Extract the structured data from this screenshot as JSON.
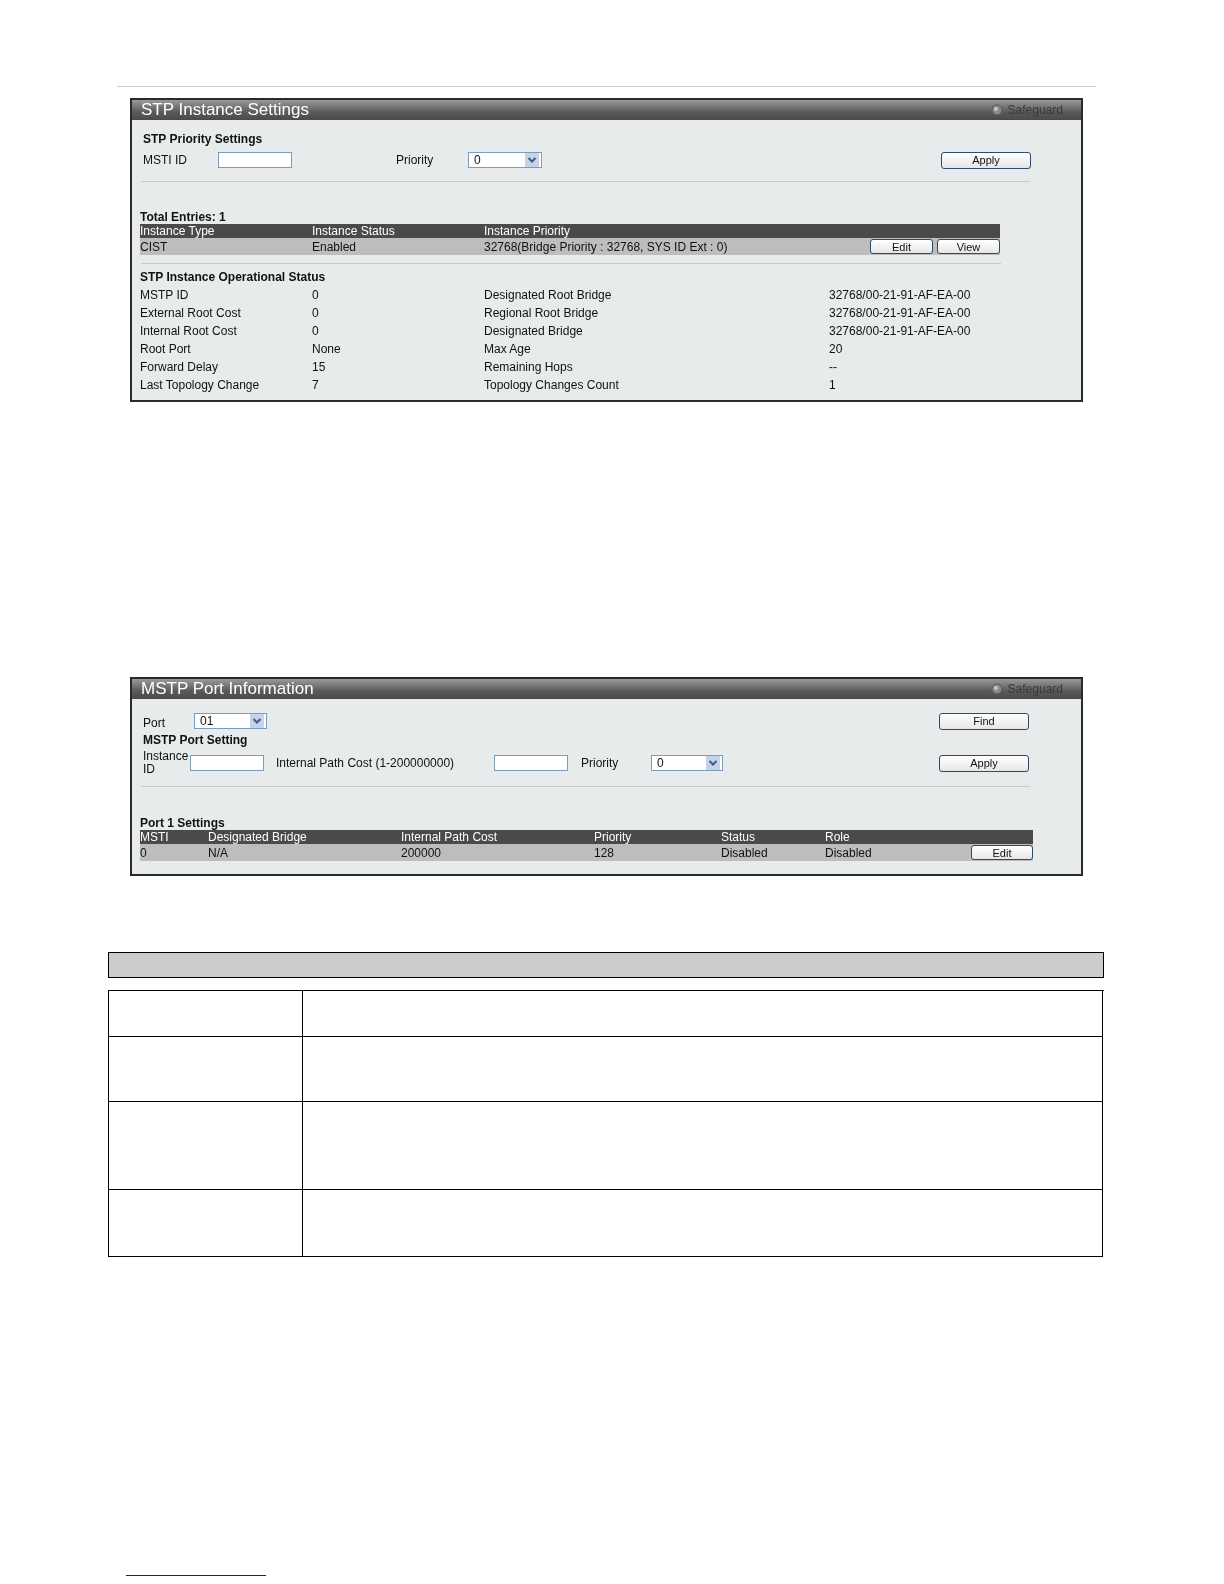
{
  "stp_instance_settings": {
    "title": "STP Instance Settings",
    "badge": "Safeguard",
    "priority_settings": {
      "heading": "STP Priority Settings",
      "msti_id_label": "MSTI ID",
      "priority_label": "Priority",
      "priority_value": "0",
      "apply_button": "Apply"
    },
    "total_entries": "Total Entries: 1",
    "table": {
      "columns": [
        "Instance Type",
        "Instance Status",
        "Instance Priority"
      ],
      "rows": [
        {
          "cells": [
            "CIST",
            "Enabled",
            "32768(Bridge Priority : 32768, SYS ID Ext : 0)"
          ],
          "buttons": [
            "Edit",
            "View"
          ]
        }
      ]
    },
    "operational_status": {
      "heading": "STP Instance Operational Status",
      "rows": [
        {
          "label": "MSTP ID",
          "value": "0",
          "label_2": "Designated Root Bridge",
          "value_2": "32768/00-21-91-AF-EA-00"
        },
        {
          "label": "External Root Cost",
          "value": "0",
          "label_2": "Regional Root Bridge",
          "value_2": "32768/00-21-91-AF-EA-00"
        },
        {
          "label": "Internal Root Cost",
          "value": "0",
          "label_2": "Designated Bridge",
          "value_2": "32768/00-21-91-AF-EA-00"
        },
        {
          "label": "Root Port",
          "value": "None",
          "label_2": "Max Age",
          "value_2": "20"
        },
        {
          "label": "Forward Delay",
          "value": "15",
          "label_2": "Remaining Hops",
          "value_2": "--"
        },
        {
          "label": "Last Topology Change",
          "value": "7",
          "label_2": "Topology Changes Count",
          "value_2": "1"
        }
      ]
    }
  },
  "mstp_port_information": {
    "title": "MSTP Port Information",
    "badge": "Safeguard",
    "port_label": "Port",
    "port_value": "01",
    "find_button": "Find",
    "port_setting": {
      "heading": "MSTP Port Setting",
      "instance_id_label": "Instance ID",
      "path_cost_label": "Internal Path Cost (1-200000000)",
      "priority_label": "Priority",
      "priority_value": "0",
      "apply_button": "Apply"
    },
    "settings_heading": "Port 1 Settings",
    "table": {
      "columns": [
        "MSTI",
        "Designated Bridge",
        "Internal Path Cost",
        "Priority",
        "Status",
        "Role"
      ],
      "rows": [
        {
          "cells": [
            "0",
            "N/A",
            "200000",
            "128",
            "Disabled",
            "Disabled"
          ],
          "buttons": [
            "Edit"
          ]
        }
      ]
    }
  }
}
